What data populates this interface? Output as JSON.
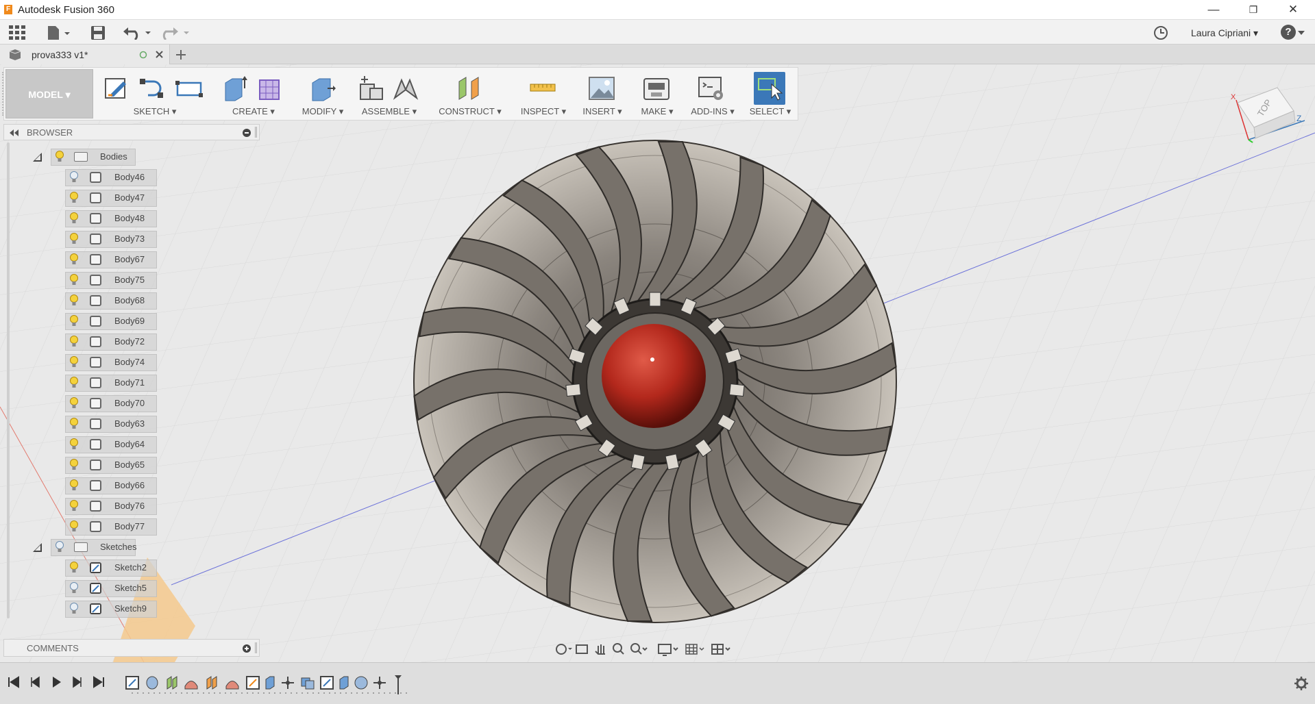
{
  "app": {
    "title": "Autodesk Fusion 360",
    "logo_letter": "F"
  },
  "window_controls": {
    "minimize": "—",
    "maximize": "❐",
    "close": "✕"
  },
  "quick_access": {
    "user_name": "Laura Cipriani ▾",
    "help": "?"
  },
  "document_tab": {
    "name": "prova333 v1*"
  },
  "toolbar": {
    "workspace": "MODEL ▾",
    "groups": [
      {
        "label": "SKETCH ▾"
      },
      {
        "label": "CREATE ▾"
      },
      {
        "label": "MODIFY ▾"
      },
      {
        "label": "ASSEMBLE ▾"
      },
      {
        "label": "CONSTRUCT ▾"
      },
      {
        "label": "INSPECT ▾"
      },
      {
        "label": "INSERT ▾"
      },
      {
        "label": "MAKE ▾"
      },
      {
        "label": "ADD-INS ▾"
      },
      {
        "label": "SELECT ▾"
      }
    ]
  },
  "browser": {
    "title": "BROWSER",
    "bodies_folder": "Bodies",
    "bodies": [
      "Body46",
      "Body47",
      "Body48",
      "Body73",
      "Body67",
      "Body75",
      "Body68",
      "Body69",
      "Body72",
      "Body74",
      "Body71",
      "Body70",
      "Body63",
      "Body64",
      "Body65",
      "Body66",
      "Body76",
      "Body77"
    ],
    "sketches_folder": "Sketches",
    "sketches": [
      "Sketch2",
      "Sketch5",
      "Sketch9"
    ]
  },
  "comments": {
    "title": "COMMENTS"
  },
  "viewcube": {
    "face": "TOP",
    "x_axis": "X",
    "z_axis": "Z"
  },
  "colors": {
    "accent_blue": "#3b78b8",
    "hub_red": "#b3281c",
    "bulb_yellow": "#f4d23c",
    "blade_gray": "#6e6a66"
  }
}
